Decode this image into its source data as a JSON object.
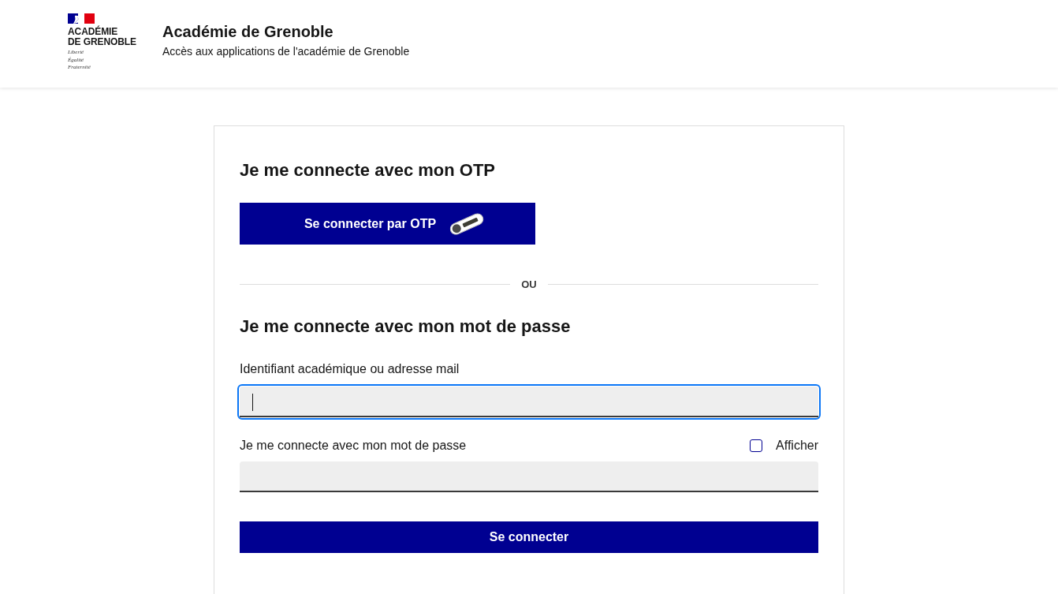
{
  "header": {
    "logo": {
      "lines": [
        "ACADÉMIE",
        "DE GRENOBLE"
      ],
      "motto": [
        "Liberté",
        "Égalité",
        "Fraternité"
      ]
    },
    "title": "Académie de Grenoble",
    "subtitle": "Accès aux applications de l'académie de Grenoble"
  },
  "otp_section": {
    "title": "Je me connecte avec mon OTP",
    "button": "Se connecter par OTP"
  },
  "separator": "OU",
  "password_section": {
    "title": "Je me connecte avec mon mot de passe",
    "fields": [
      {
        "label": "Identifiant académique ou adresse mail",
        "focused": true
      },
      {
        "label": "Je me connecte avec mon mot de passe",
        "focused": false,
        "show_toggle": {
          "label": "Afficher",
          "checked": false
        }
      }
    ],
    "submit": "Se connecter"
  }
}
